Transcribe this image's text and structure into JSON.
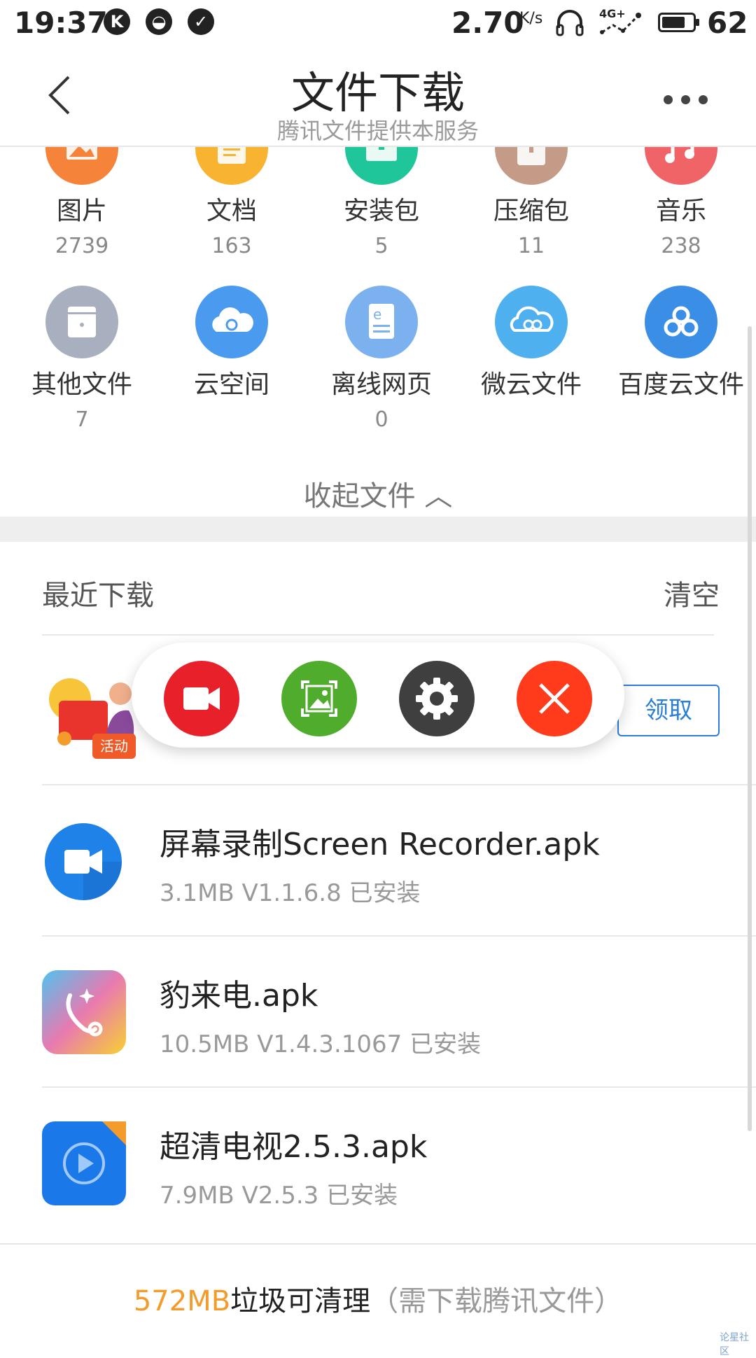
{
  "status_bar": {
    "time": "19:37",
    "network_speed": "2.70",
    "speed_unit": "K/s",
    "network_type": "4G+",
    "battery": "62",
    "icons": [
      "k-app-icon",
      "emoji-icon",
      "check-circle-icon",
      "headset-icon",
      "signal-icon",
      "battery-icon"
    ]
  },
  "header": {
    "title": "文件下载",
    "subtitle": "腾讯文件提供本服务"
  },
  "categories": [
    {
      "label": "图片",
      "count": "2739",
      "color": "#f5833a",
      "icon": "image-icon"
    },
    {
      "label": "文档",
      "count": "163",
      "color": "#f8b431",
      "icon": "document-icon"
    },
    {
      "label": "安装包",
      "count": "5",
      "color": "#1ec69a",
      "icon": "package-icon"
    },
    {
      "label": "压缩包",
      "count": "11",
      "color": "#c49b86",
      "icon": "archive-icon"
    },
    {
      "label": "音乐",
      "count": "238",
      "color": "#f06468",
      "icon": "music-icon"
    },
    {
      "label": "其他文件",
      "count": "7",
      "color": "#a8b0c0",
      "icon": "other-file-icon"
    },
    {
      "label": "云空间",
      "count": "",
      "color": "#4a9af0",
      "icon": "cloud-sync-icon"
    },
    {
      "label": "离线网页",
      "count": "0",
      "color": "#7cb1f0",
      "icon": "offline-page-icon"
    },
    {
      "label": "微云文件",
      "count": "",
      "color": "#4fb0f0",
      "icon": "weiyun-icon"
    },
    {
      "label": "百度云文件",
      "count": "",
      "color": "#3a8ee6",
      "icon": "baidu-cloud-icon"
    }
  ],
  "collapse_label": "收起文件 ︿",
  "recent": {
    "title": "最近下载",
    "clear": "清空"
  },
  "promo": {
    "badge": "活动",
    "claim": "领取"
  },
  "floating_toolbar": [
    {
      "name": "record-video-button",
      "color": "#e8202a",
      "icon": "video-camera-icon"
    },
    {
      "name": "screenshot-button",
      "color": "#4fac2c",
      "icon": "gallery-icon"
    },
    {
      "name": "settings-button",
      "color": "#3f3f3f",
      "icon": "gear-icon"
    },
    {
      "name": "close-button",
      "color": "#ff3b1c",
      "icon": "close-icon"
    }
  ],
  "items": [
    {
      "name": "屏幕录制Screen Recorder.apk",
      "meta": "3.1MB  V1.1.6.8 已安装"
    },
    {
      "name": "豹来电.apk",
      "meta": "10.5MB  V1.4.3.1067 已安装"
    },
    {
      "name": "超清电视2.5.3.apk",
      "meta": "7.9MB  V2.5.3 已安装"
    }
  ],
  "bottom": {
    "amount": "572MB",
    "main": "垃圾可清理",
    "hint": "（需下载腾讯文件）"
  },
  "watermark": "论星社区"
}
